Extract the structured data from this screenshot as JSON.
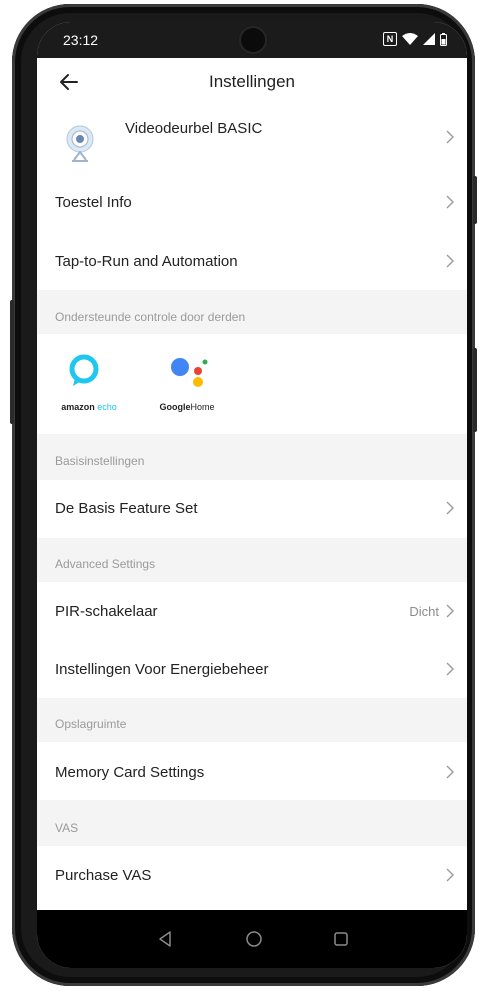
{
  "status_bar": {
    "time": "23:12",
    "nfc_label": "N"
  },
  "header": {
    "title": "Instellingen"
  },
  "device": {
    "name": "Videodeurbel BASIC"
  },
  "rows": {
    "toestel_info": "Toestel Info",
    "tap_to_run": "Tap-to-Run and Automation",
    "basis_feature_set": "De Basis Feature Set",
    "pir_switch": "PIR-schakelaar",
    "pir_value": "Dicht",
    "energie": "Instellingen Voor Energiebeheer",
    "memory_card": "Memory Card Settings",
    "purchase_vas": "Purchase VAS"
  },
  "sections": {
    "third_party": "Ondersteunde controle door derden",
    "basic": "Basisinstellingen",
    "advanced": "Advanced Settings",
    "storage": "Opslagruimte",
    "vas": "VAS"
  },
  "integrations": {
    "alexa": {
      "brand": "amazon",
      "product": "echo"
    },
    "google": {
      "brand": "Google",
      "product": "Home"
    }
  },
  "colors": {
    "alexa_blue": "#1ec7f0",
    "google_blue": "#4285f4",
    "google_red": "#ea4335",
    "google_yellow": "#fbbc05",
    "google_green": "#34a853",
    "section_bg": "#f4f4f4"
  }
}
